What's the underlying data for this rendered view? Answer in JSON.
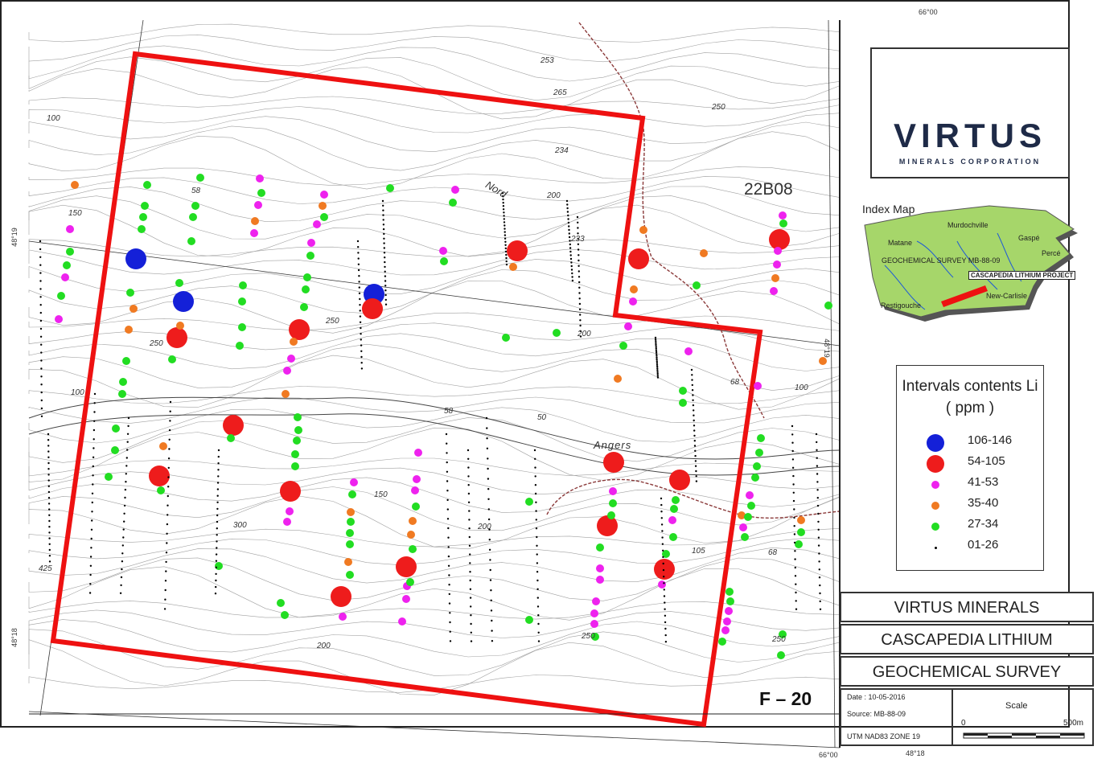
{
  "company": {
    "logo_word": "VIRTUS",
    "logo_sub": "MINERALS CORPORATION",
    "hex_colors": [
      "#f4b048",
      "#1e3fb0",
      "#5ee36e"
    ]
  },
  "sheet": "22B08",
  "figure": "F – 20",
  "coordinates": {
    "top_lon": "66°00",
    "bottom_lon": "66°00",
    "bottom_lat_right": "48°18",
    "left_lat_top": "48°19",
    "left_lat_bottom": "48°18",
    "right_lat": "48°19"
  },
  "map_text": {
    "nord": "Nord",
    "angers": "Angers",
    "contours": [
      "253",
      "265",
      "250",
      "234",
      "200",
      "233",
      "250",
      "200",
      "250",
      "100",
      "68",
      "58",
      "50",
      "58",
      "100",
      "150",
      "300",
      "425",
      "200",
      "250",
      "105",
      "100",
      "68",
      "200",
      "250",
      "150"
    ]
  },
  "index_map": {
    "title": "Index Map",
    "places": [
      "Murdochville",
      "Matane",
      "Gaspé",
      "Percé",
      "New-Carlisle",
      "Restigouche"
    ],
    "survey_label": "GEOCHEMICAL SURVEY MB-88-09",
    "project_label": "CASCAPEDIA LITHIUM PROJECT"
  },
  "legend": {
    "title": "Intervals contents Li",
    "subtitle": "( ppm )",
    "items": [
      {
        "label": "106-146",
        "color": "#1420d8"
      },
      {
        "label": "54-105",
        "color": "#ee1c1c"
      },
      {
        "label": "41-53",
        "color": "#ee22ee"
      },
      {
        "label": "35-40",
        "color": "#f07a22"
      },
      {
        "label": "27-34",
        "color": "#22dd22"
      },
      {
        "label": "01-26",
        "color": "#000000"
      }
    ]
  },
  "title_block": {
    "company": "VIRTUS MINERALS CORPORATION",
    "project": "CASCAPEDIA LITHIUM PROJECT",
    "survey": "GEOCHEMICAL SURVEY",
    "date": "Date : 10-05-2016",
    "source": "Source:  MB-88-09",
    "datum": "UTM NAD83 ZONE 19",
    "scale_label": "Scale",
    "scale_start": "0",
    "scale_end": "500m"
  },
  "colors": {
    "boundary": "#ee1111",
    "high": "#1420d8",
    "mid": "#ee1c1c",
    "moderate": "#ee22ee",
    "lowmod": "#f07a22",
    "low": "#22dd22",
    "trace": "#000000"
  }
}
